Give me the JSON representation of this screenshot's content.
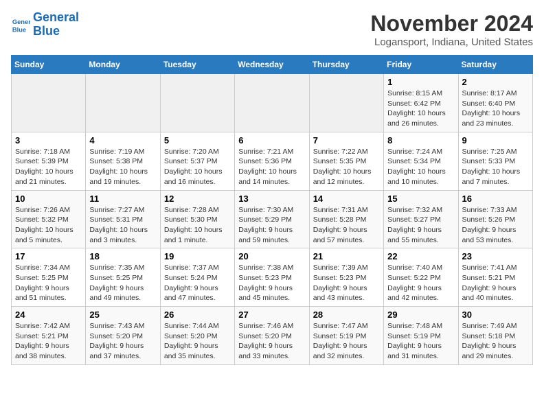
{
  "header": {
    "month_title": "November 2024",
    "location": "Logansport, Indiana, United States",
    "logo_line1": "General",
    "logo_line2": "Blue"
  },
  "weekdays": [
    "Sunday",
    "Monday",
    "Tuesday",
    "Wednesday",
    "Thursday",
    "Friday",
    "Saturday"
  ],
  "weeks": [
    [
      {
        "day": "",
        "empty": true
      },
      {
        "day": "",
        "empty": true
      },
      {
        "day": "",
        "empty": true
      },
      {
        "day": "",
        "empty": true
      },
      {
        "day": "",
        "empty": true
      },
      {
        "day": "1",
        "sunrise": "Sunrise: 8:15 AM",
        "sunset": "Sunset: 6:42 PM",
        "daylight": "Daylight: 10 hours and 26 minutes."
      },
      {
        "day": "2",
        "sunrise": "Sunrise: 8:17 AM",
        "sunset": "Sunset: 6:40 PM",
        "daylight": "Daylight: 10 hours and 23 minutes."
      }
    ],
    [
      {
        "day": "3",
        "sunrise": "Sunrise: 7:18 AM",
        "sunset": "Sunset: 5:39 PM",
        "daylight": "Daylight: 10 hours and 21 minutes."
      },
      {
        "day": "4",
        "sunrise": "Sunrise: 7:19 AM",
        "sunset": "Sunset: 5:38 PM",
        "daylight": "Daylight: 10 hours and 19 minutes."
      },
      {
        "day": "5",
        "sunrise": "Sunrise: 7:20 AM",
        "sunset": "Sunset: 5:37 PM",
        "daylight": "Daylight: 10 hours and 16 minutes."
      },
      {
        "day": "6",
        "sunrise": "Sunrise: 7:21 AM",
        "sunset": "Sunset: 5:36 PM",
        "daylight": "Daylight: 10 hours and 14 minutes."
      },
      {
        "day": "7",
        "sunrise": "Sunrise: 7:22 AM",
        "sunset": "Sunset: 5:35 PM",
        "daylight": "Daylight: 10 hours and 12 minutes."
      },
      {
        "day": "8",
        "sunrise": "Sunrise: 7:24 AM",
        "sunset": "Sunset: 5:34 PM",
        "daylight": "Daylight: 10 hours and 10 minutes."
      },
      {
        "day": "9",
        "sunrise": "Sunrise: 7:25 AM",
        "sunset": "Sunset: 5:33 PM",
        "daylight": "Daylight: 10 hours and 7 minutes."
      }
    ],
    [
      {
        "day": "10",
        "sunrise": "Sunrise: 7:26 AM",
        "sunset": "Sunset: 5:32 PM",
        "daylight": "Daylight: 10 hours and 5 minutes."
      },
      {
        "day": "11",
        "sunrise": "Sunrise: 7:27 AM",
        "sunset": "Sunset: 5:31 PM",
        "daylight": "Daylight: 10 hours and 3 minutes."
      },
      {
        "day": "12",
        "sunrise": "Sunrise: 7:28 AM",
        "sunset": "Sunset: 5:30 PM",
        "daylight": "Daylight: 10 hours and 1 minute."
      },
      {
        "day": "13",
        "sunrise": "Sunrise: 7:30 AM",
        "sunset": "Sunset: 5:29 PM",
        "daylight": "Daylight: 9 hours and 59 minutes."
      },
      {
        "day": "14",
        "sunrise": "Sunrise: 7:31 AM",
        "sunset": "Sunset: 5:28 PM",
        "daylight": "Daylight: 9 hours and 57 minutes."
      },
      {
        "day": "15",
        "sunrise": "Sunrise: 7:32 AM",
        "sunset": "Sunset: 5:27 PM",
        "daylight": "Daylight: 9 hours and 55 minutes."
      },
      {
        "day": "16",
        "sunrise": "Sunrise: 7:33 AM",
        "sunset": "Sunset: 5:26 PM",
        "daylight": "Daylight: 9 hours and 53 minutes."
      }
    ],
    [
      {
        "day": "17",
        "sunrise": "Sunrise: 7:34 AM",
        "sunset": "Sunset: 5:25 PM",
        "daylight": "Daylight: 9 hours and 51 minutes."
      },
      {
        "day": "18",
        "sunrise": "Sunrise: 7:35 AM",
        "sunset": "Sunset: 5:25 PM",
        "daylight": "Daylight: 9 hours and 49 minutes."
      },
      {
        "day": "19",
        "sunrise": "Sunrise: 7:37 AM",
        "sunset": "Sunset: 5:24 PM",
        "daylight": "Daylight: 9 hours and 47 minutes."
      },
      {
        "day": "20",
        "sunrise": "Sunrise: 7:38 AM",
        "sunset": "Sunset: 5:23 PM",
        "daylight": "Daylight: 9 hours and 45 minutes."
      },
      {
        "day": "21",
        "sunrise": "Sunrise: 7:39 AM",
        "sunset": "Sunset: 5:23 PM",
        "daylight": "Daylight: 9 hours and 43 minutes."
      },
      {
        "day": "22",
        "sunrise": "Sunrise: 7:40 AM",
        "sunset": "Sunset: 5:22 PM",
        "daylight": "Daylight: 9 hours and 42 minutes."
      },
      {
        "day": "23",
        "sunrise": "Sunrise: 7:41 AM",
        "sunset": "Sunset: 5:21 PM",
        "daylight": "Daylight: 9 hours and 40 minutes."
      }
    ],
    [
      {
        "day": "24",
        "sunrise": "Sunrise: 7:42 AM",
        "sunset": "Sunset: 5:21 PM",
        "daylight": "Daylight: 9 hours and 38 minutes."
      },
      {
        "day": "25",
        "sunrise": "Sunrise: 7:43 AM",
        "sunset": "Sunset: 5:20 PM",
        "daylight": "Daylight: 9 hours and 37 minutes."
      },
      {
        "day": "26",
        "sunrise": "Sunrise: 7:44 AM",
        "sunset": "Sunset: 5:20 PM",
        "daylight": "Daylight: 9 hours and 35 minutes."
      },
      {
        "day": "27",
        "sunrise": "Sunrise: 7:46 AM",
        "sunset": "Sunset: 5:20 PM",
        "daylight": "Daylight: 9 hours and 33 minutes."
      },
      {
        "day": "28",
        "sunrise": "Sunrise: 7:47 AM",
        "sunset": "Sunset: 5:19 PM",
        "daylight": "Daylight: 9 hours and 32 minutes."
      },
      {
        "day": "29",
        "sunrise": "Sunrise: 7:48 AM",
        "sunset": "Sunset: 5:19 PM",
        "daylight": "Daylight: 9 hours and 31 minutes."
      },
      {
        "day": "30",
        "sunrise": "Sunrise: 7:49 AM",
        "sunset": "Sunset: 5:18 PM",
        "daylight": "Daylight: 9 hours and 29 minutes."
      }
    ]
  ]
}
